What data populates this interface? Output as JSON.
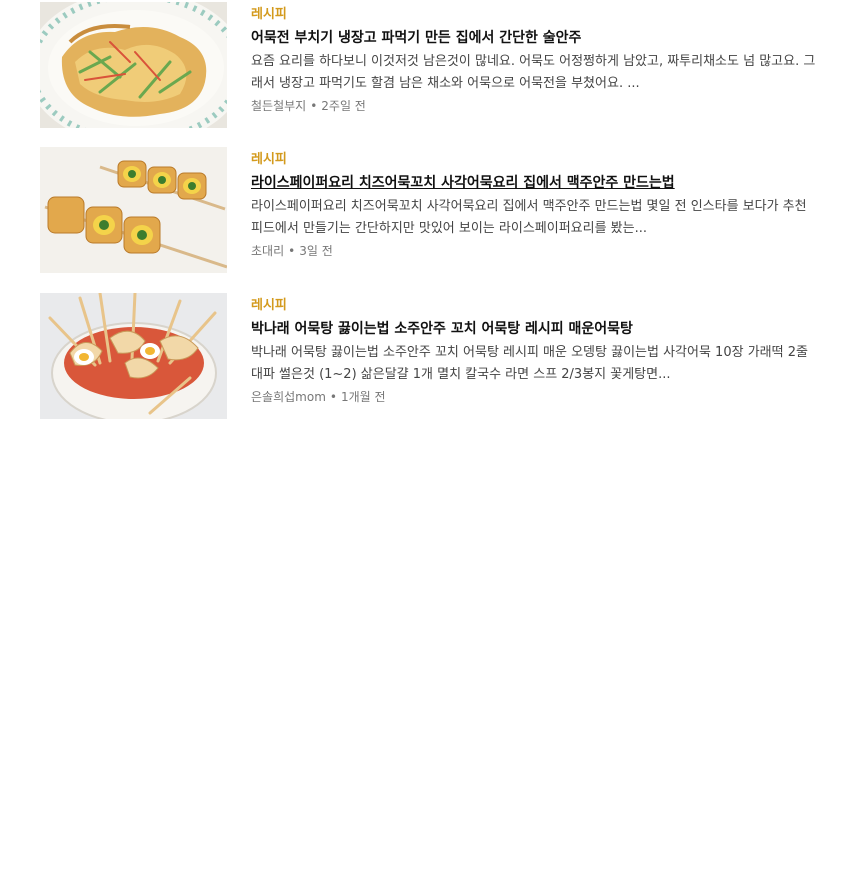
{
  "articles": [
    {
      "category": "레시피",
      "title": "어묵전 부치기 냉장고 파먹기 만든 집에서 간단한 술안주",
      "description": "요즘 요리를 하다보니 이것저것 남은것이 많네요. 어묵도 어정쩡하게 남았고, 짜투리채소도 넘 많고요. 그래서 냉장고 파먹기도 할겸 남은 채소와 어묵으로 어묵전을 부쳤어요. ...",
      "author": "철든철부지",
      "separator": "•",
      "time": "2주일 전",
      "thumbnail": "fish-cake-pancake-image"
    },
    {
      "category": "레시피",
      "title": "라이스페이퍼요리 치즈어묵꼬치 사각어묵요리 집에서 맥주안주 만드는법",
      "description": "라이스페이퍼요리 치즈어묵꼬치 사각어묵요리 집에서 맥주안주 만드는법 몇일 전 인스타를 보다가 추천 피드에서 만들기는 간단하지만 맛있어 보이는 라이스페이퍼요리를 봤는...",
      "author": "초대리",
      "separator": "•",
      "time": "3일 전",
      "thumbnail": "cheese-fishcake-skewer-image"
    },
    {
      "category": "레시피",
      "title": "박나래 어묵탕 끓이는법 소주안주 꼬치 어묵탕 레시피 매운어묵탕",
      "description": "박나래 어묵탕 끓이는법 소주안주 꼬치 어묵탕 레시피 매운 오뎅탕 끓이는법 사각어묵 10장 가래떡 2줄 대파 썰은것 (1~2) 삶은달걀 1개 멸치 칼국수 라면 스프 2/3봉지 꽃게탕면...",
      "author": "은솔희섭mom",
      "separator": "•",
      "time": "1개월 전",
      "thumbnail": "spicy-fishcake-soup-image"
    }
  ]
}
